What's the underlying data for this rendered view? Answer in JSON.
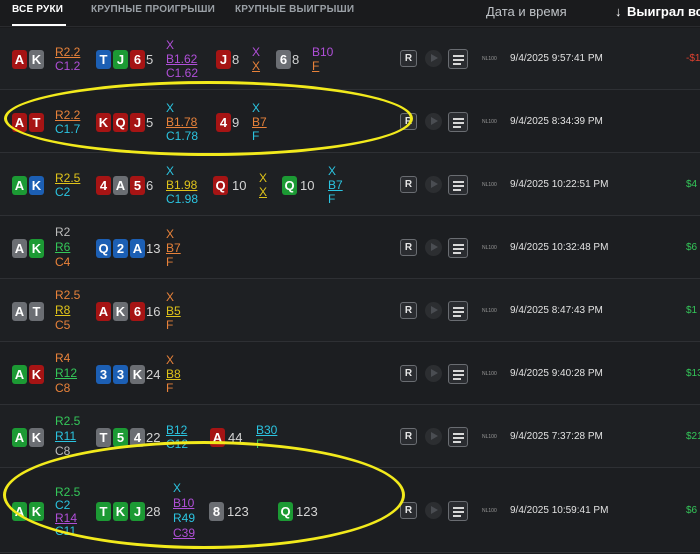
{
  "tabs": [
    "ВСЕ РУКИ",
    "КРУПНЫЕ ПРОИГРЫШИ",
    "КРУПНЫЕ ВЫИГРЫШИ"
  ],
  "columns": {
    "date": "Дата и время",
    "sort_arrow": "↓",
    "won": "Выиграл все"
  },
  "buttons": {
    "replay": "R"
  },
  "colors": {
    "hearts": "#a61414",
    "diamonds": "#1c5fb4",
    "clubs": "#1c9a34",
    "spades": "#6b6e73",
    "highlight": "#f2ea1c"
  },
  "rows": [
    {
      "hole": [
        "A",
        "K"
      ],
      "preflop": [
        "R2.2",
        "C1.2"
      ],
      "flop_cards": [
        "T",
        "J",
        "6"
      ],
      "flop_pot": "5",
      "flop_actions": [
        "X",
        "B1.62",
        "C1.62"
      ],
      "turn_cards": [
        "J"
      ],
      "turn_pot": "8",
      "turn_actions": [
        "X",
        "X"
      ],
      "river_cards": [
        "6"
      ],
      "river_pot": "8",
      "river_actions": [
        "B10",
        "F"
      ],
      "stake": "NL100",
      "date": "9/4/2025 9:57:41 PM",
      "result": "-$1"
    },
    {
      "hole": [
        "A",
        "T"
      ],
      "preflop": [
        "R2.2",
        "C1.7"
      ],
      "flop_cards": [
        "K",
        "Q",
        "J"
      ],
      "flop_pot": "5",
      "flop_actions": [
        "X",
        "B1.78",
        "C1.78"
      ],
      "turn_cards": [
        "4"
      ],
      "turn_pot": "9",
      "turn_actions": [
        "X",
        "B7",
        "F"
      ],
      "stake": "NL100",
      "date": "9/4/2025 8:34:39 PM",
      "result": ""
    },
    {
      "hole": [
        "A",
        "K"
      ],
      "preflop": [
        "R2.5",
        "C2"
      ],
      "flop_cards": [
        "4",
        "A",
        "5"
      ],
      "flop_pot": "6",
      "flop_actions": [
        "X",
        "B1.98",
        "C1.98"
      ],
      "turn_cards": [
        "Q"
      ],
      "turn_pot": "10",
      "turn_actions": [
        "X",
        "X"
      ],
      "river_cards": [
        "Q"
      ],
      "river_pot": "10",
      "river_actions": [
        "X",
        "B7",
        "F"
      ],
      "stake": "NL100",
      "date": "9/4/2025 10:22:51 PM",
      "result": "$4"
    },
    {
      "hole": [
        "A",
        "K"
      ],
      "preflop": [
        "R2",
        "R6",
        "C4"
      ],
      "flop_cards": [
        "Q",
        "2",
        "A"
      ],
      "flop_pot": "13",
      "flop_actions": [
        "X",
        "B7",
        "F"
      ],
      "stake": "NL100",
      "date": "9/4/2025 10:32:48 PM",
      "result": "$6"
    },
    {
      "hole": [
        "A",
        "T"
      ],
      "preflop": [
        "R2.5",
        "R8",
        "C5"
      ],
      "flop_cards": [
        "A",
        "K",
        "6"
      ],
      "flop_pot": "16",
      "flop_actions": [
        "X",
        "B5",
        "F"
      ],
      "stake": "NL100",
      "date": "9/4/2025 8:47:43 PM",
      "result": "$1"
    },
    {
      "hole": [
        "A",
        "K"
      ],
      "preflop": [
        "R4",
        "R12",
        "C8"
      ],
      "flop_cards": [
        "3",
        "3",
        "K"
      ],
      "flop_pot": "24",
      "flop_actions": [
        "X",
        "B8",
        "F"
      ],
      "stake": "NL100",
      "date": "9/4/2025 9:40:28 PM",
      "result": "$13"
    },
    {
      "hole": [
        "A",
        "K"
      ],
      "preflop": [
        "R2.5",
        "R11",
        "C8"
      ],
      "flop_cards": [
        "T",
        "5",
        "4"
      ],
      "flop_pot": "22",
      "flop_actions": [
        "B12",
        "C12"
      ],
      "turn_cards": [
        "A"
      ],
      "turn_pot": "44",
      "turn_actions": [
        "B30",
        "F"
      ],
      "stake": "NL100",
      "date": "9/4/2025 7:37:28 PM",
      "result": "$21"
    },
    {
      "hole": [
        "A",
        "K"
      ],
      "preflop": [
        "R2.5",
        "C2",
        "R14",
        "C11"
      ],
      "flop_cards": [
        "T",
        "K",
        "J"
      ],
      "flop_pot": "28",
      "flop_actions": [
        "X",
        "B10",
        "R49",
        "C39"
      ],
      "turn_cards": [
        "8"
      ],
      "turn_pot": "123",
      "river_cards": [
        "Q"
      ],
      "river_pot": "123",
      "stake": "NL100",
      "date": "9/4/2025 10:59:41 PM",
      "result": "$6"
    }
  ]
}
